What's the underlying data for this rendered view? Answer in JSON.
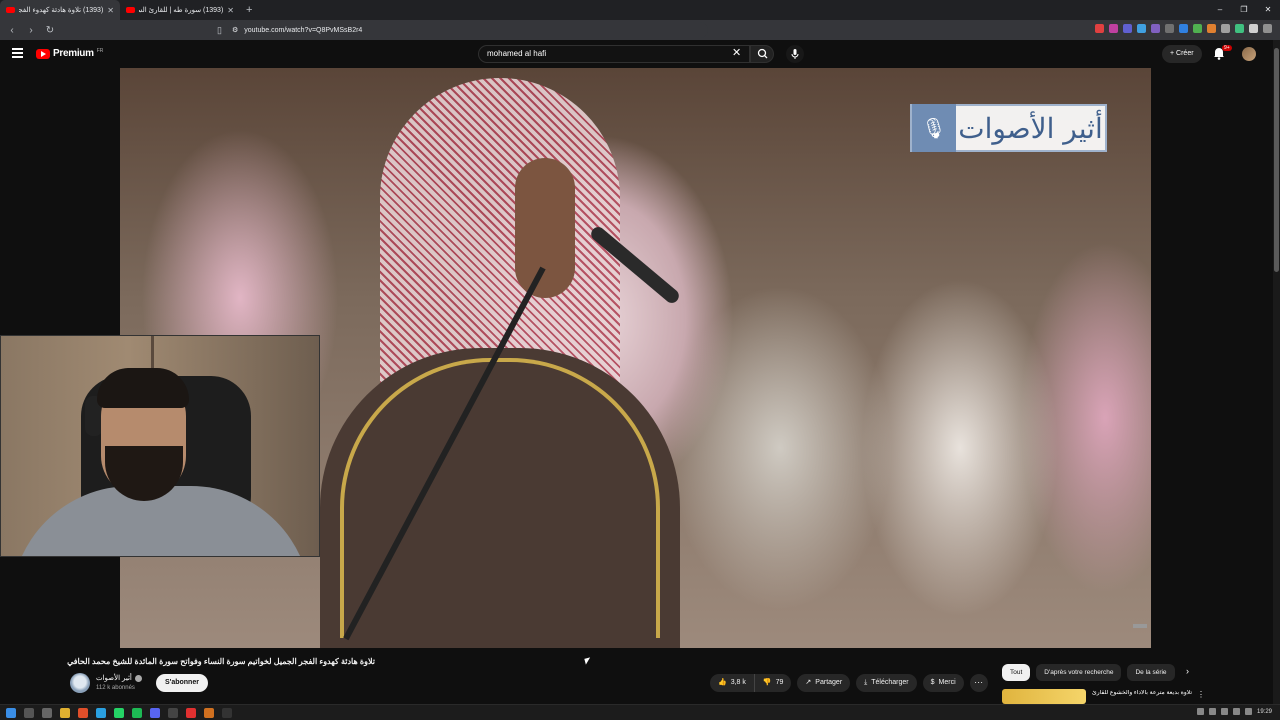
{
  "browser": {
    "tabs": [
      {
        "title": "(1393) تلاوة هادئة كهدوء الفجر الج...",
        "active": true
      },
      {
        "title": "(1393) سورة طه | للقارئ السنغالي الش...",
        "active": false
      }
    ],
    "new_tab": "+",
    "window_controls": [
      "–",
      "❐",
      "✕"
    ],
    "url": "youtube.com/watch?v=Q8PvMSsB2r4"
  },
  "youtube": {
    "brand": "Premium",
    "region": "FR",
    "search_value": "mohamed al hafi",
    "create_label": "Créer",
    "notifications_badge": "9+"
  },
  "video": {
    "watermark_text": "أثير الأصوات",
    "title": "تلاوة هادئة كهدوء الفجر الجميل لخواتيم سورة النساء وفواتح سورة المائدة للشيخ محمد الحافي"
  },
  "channel": {
    "name": "أثير الأصوات",
    "subscribers": "112 k abonnés",
    "subscribe_label": "S'abonner"
  },
  "actions": {
    "likes": "3,8 k",
    "dislikes": "79",
    "share": "Partager",
    "download": "Télécharger",
    "thanks": "Merci",
    "more": "···"
  },
  "chips": {
    "items": [
      "Tout",
      "D'après votre recherche",
      "De la série"
    ],
    "next": "›"
  },
  "recommendation": {
    "title": "تلاوة بديعة مترعة بالأداء والخشوع للقارئ سورة"
  },
  "taskbar": {
    "time": "19:29"
  }
}
